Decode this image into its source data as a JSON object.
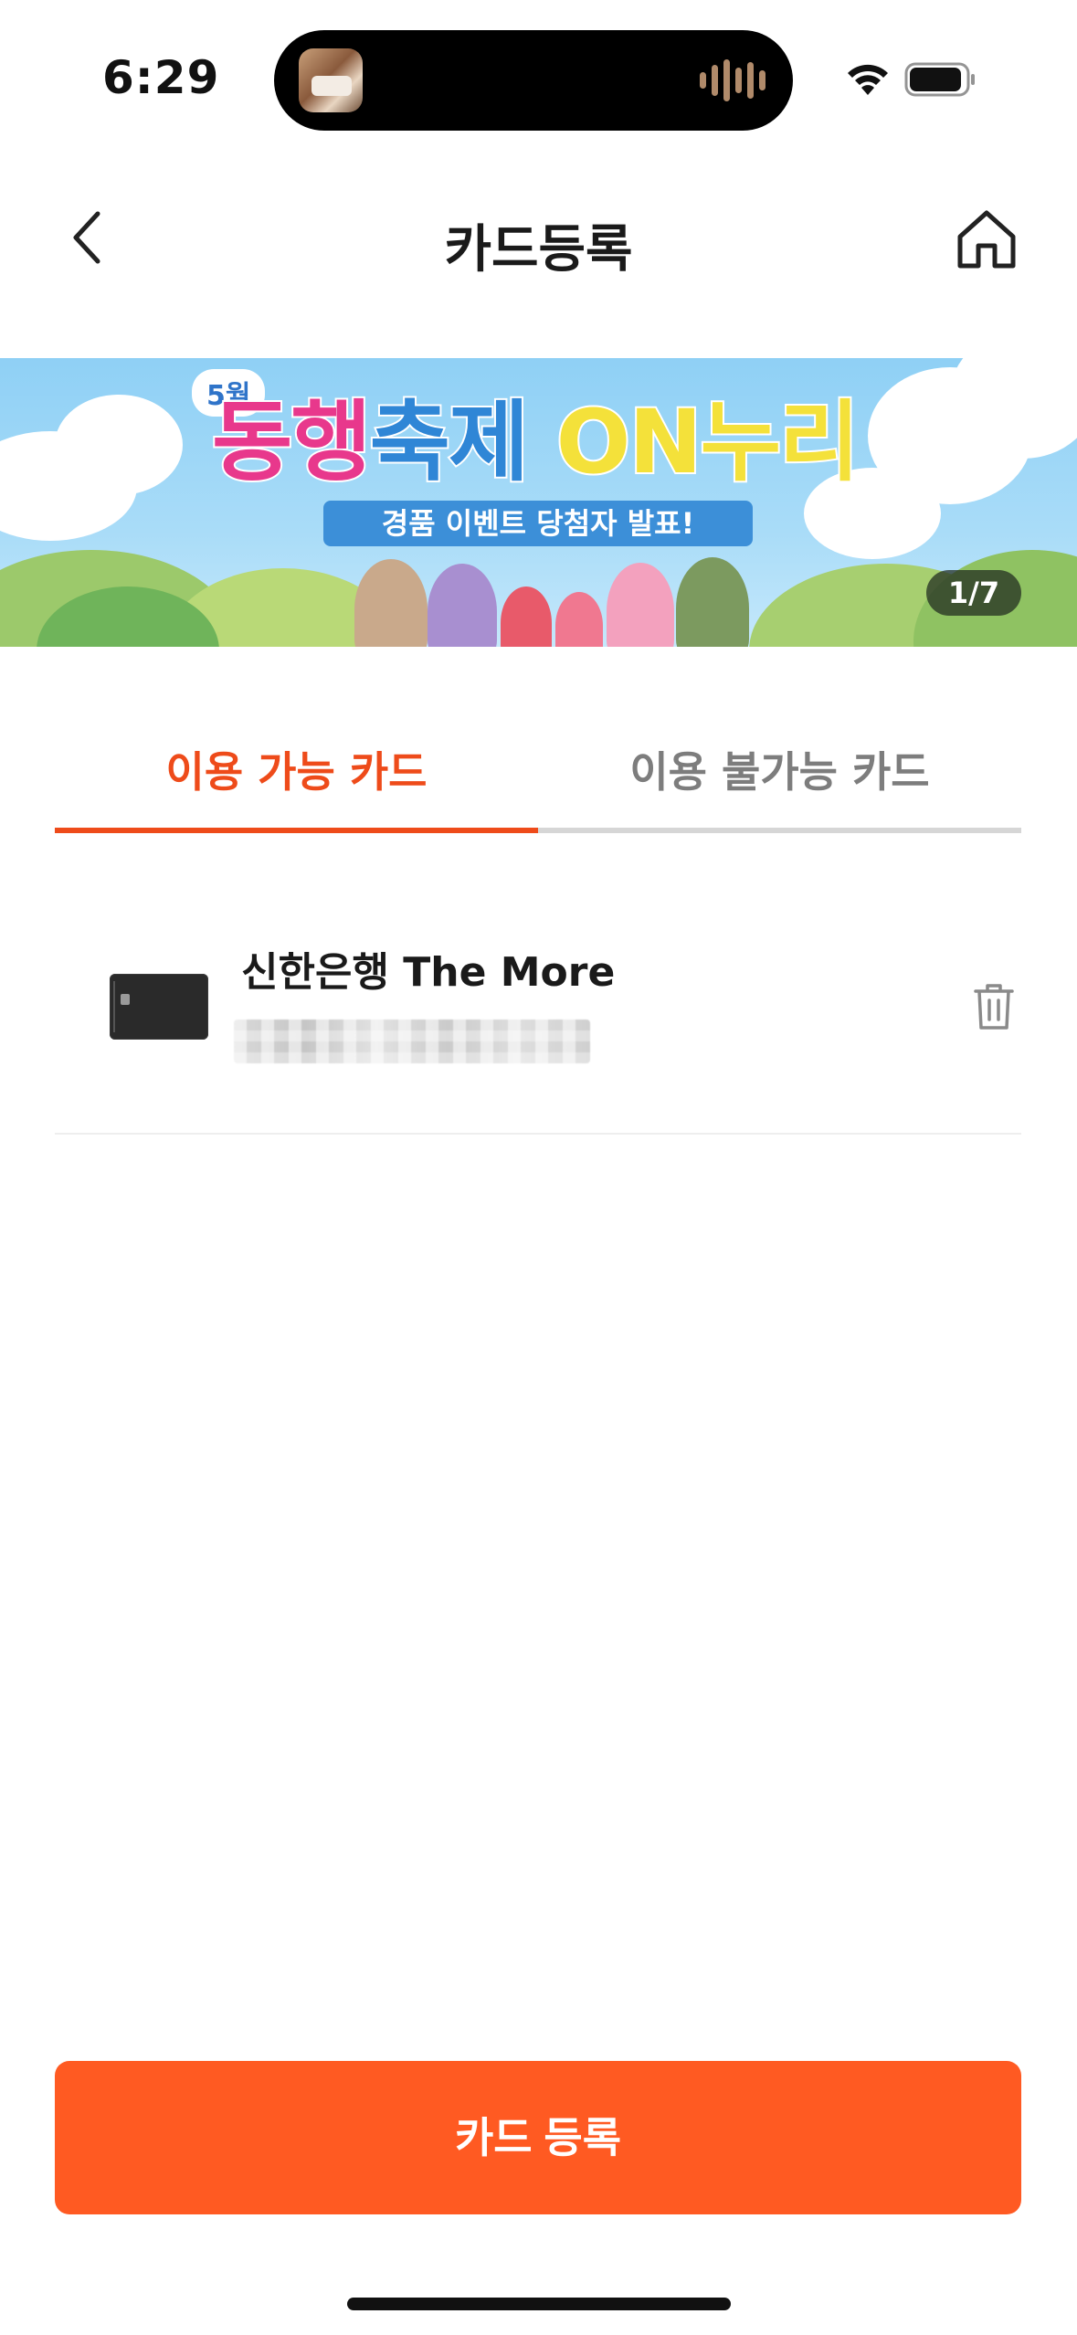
{
  "status_bar": {
    "time": "6:29",
    "icons": [
      "now-playing-thumbnail",
      "audio-wave-icon",
      "wifi-icon",
      "battery-icon"
    ]
  },
  "nav": {
    "title": "카드등록",
    "back_icon": "chevron-left-icon",
    "home_icon": "home-icon"
  },
  "banner": {
    "month_badge": "5월",
    "title_part1": "동행",
    "title_part2": "축제",
    "title_part3": "ON누리",
    "subtitle": "경품 이벤트 당첨자 발표!",
    "counter": "1/7"
  },
  "tabs": [
    {
      "label": "이용 가능 카드",
      "active": true
    },
    {
      "label": "이용 불가능 카드",
      "active": false
    }
  ],
  "cards": [
    {
      "name": "신한은행 The More",
      "number_masked": true,
      "delete_icon": "trash-icon"
    }
  ],
  "actions": {
    "register_label": "카드 등록"
  },
  "colors": {
    "accent": "#ee4b1a",
    "button": "#ff5a22",
    "inactive_tab": "#7d7d7d",
    "divider": "#d6d6d6"
  }
}
